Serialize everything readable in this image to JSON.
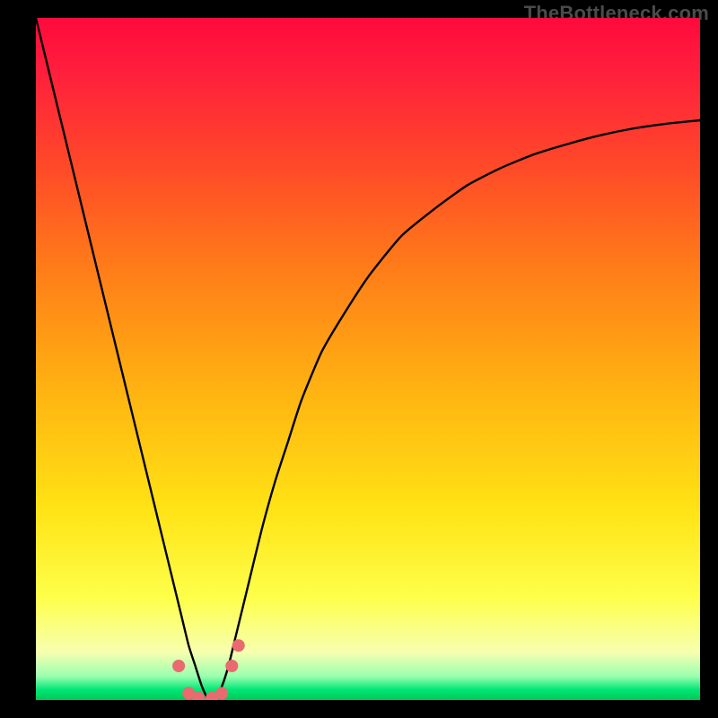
{
  "attribution": "TheBottleneck.com",
  "colors": {
    "gradient_top": "#ff0a3c",
    "gradient_mid": "#ffe315",
    "gradient_bottom": "#00c853",
    "curve_stroke": "#000000",
    "marker_fill": "#e96a6f"
  },
  "chart_data": {
    "type": "line",
    "title": "",
    "xlabel": "",
    "ylabel": "",
    "xlim": [
      0,
      100
    ],
    "ylim": [
      0,
      100
    ],
    "series": [
      {
        "name": "bottleneck-curve",
        "x": [
          0,
          2,
          4,
          6,
          8,
          10,
          12,
          14,
          16,
          18,
          20,
          22,
          23,
          24,
          25,
          26,
          27,
          28,
          29,
          30,
          32,
          34,
          36,
          38,
          40,
          43,
          46,
          50,
          55,
          60,
          65,
          70,
          75,
          80,
          85,
          90,
          95,
          100
        ],
        "values": [
          100,
          92,
          84,
          76,
          68,
          60,
          52,
          44,
          36,
          28,
          20,
          12,
          8,
          5,
          2,
          0,
          0,
          2,
          5,
          9,
          17,
          25,
          32,
          38,
          44,
          51,
          56,
          62,
          68,
          72,
          75.5,
          78,
          80,
          81.5,
          82.8,
          83.8,
          84.5,
          85
        ]
      }
    ],
    "markers": {
      "name": "bottom-markers",
      "x": [
        21.5,
        23.0,
        24.5,
        26.5,
        28.0,
        29.5,
        30.5
      ],
      "values": [
        5.0,
        1.0,
        0.3,
        0.3,
        1.0,
        5.0,
        8.0
      ]
    }
  }
}
